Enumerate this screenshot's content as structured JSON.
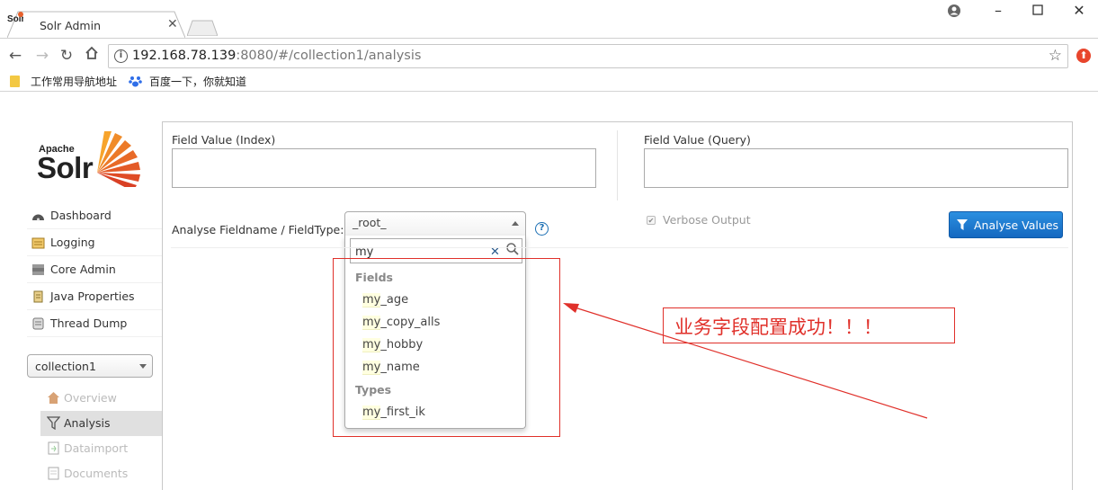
{
  "browser": {
    "tab_title": "Solr Admin",
    "url_host": "192.168.78.139",
    "url_rest": ":8080/#/collection1/analysis",
    "bookmarks": [
      "工作常用导航地址",
      "百度一下，你就知道"
    ]
  },
  "logo": {
    "small": "Apache",
    "big": "Solr"
  },
  "menu": [
    {
      "label": "Dashboard",
      "icon": "dashboard-icon"
    },
    {
      "label": "Logging",
      "icon": "logging-icon"
    },
    {
      "label": "Core Admin",
      "icon": "core-admin-icon"
    },
    {
      "label": "Java Properties",
      "icon": "java-properties-icon"
    },
    {
      "label": "Thread Dump",
      "icon": "thread-dump-icon"
    }
  ],
  "core_selector": {
    "value": "collection1"
  },
  "core_menu": [
    {
      "label": "Overview",
      "icon": "overview-icon",
      "active": false
    },
    {
      "label": "Analysis",
      "icon": "analysis-icon",
      "active": true
    },
    {
      "label": "Dataimport",
      "icon": "dataimport-icon",
      "active": false
    },
    {
      "label": "Documents",
      "icon": "documents-icon",
      "active": false
    }
  ],
  "analysis": {
    "index_label": "Field Value (Index)",
    "query_label": "Field Value (Query)",
    "fieldtype_label": "Analyse Fieldname / FieldType:",
    "fieldtype_value": "_root_",
    "verbose_label": "Verbose Output",
    "verbose_checked": true,
    "analyse_button": "Analyse Values"
  },
  "dropdown": {
    "search_text": "my",
    "groups": [
      {
        "name": "Fields",
        "options": [
          [
            "my",
            "_age"
          ],
          [
            "my",
            "_copy_alls"
          ],
          [
            "my",
            "_hobby"
          ],
          [
            "my",
            "_name"
          ]
        ]
      },
      {
        "name": "Types",
        "options": [
          [
            "my",
            "_first_ik"
          ]
        ]
      }
    ]
  },
  "annotation": {
    "text": "业务字段配置成功！！！",
    "color": "#e0302a"
  }
}
